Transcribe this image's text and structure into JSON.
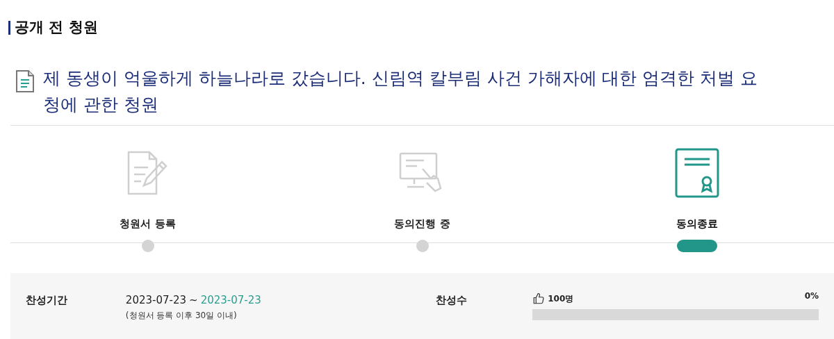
{
  "section_title": "공개 전 청원",
  "petition_title": "제 동생이 억울하게 하늘나라로 갔습니다. 신림역 칼부림 사건 가해자에 대한 엄격한 처벌 요청에 관한 청원",
  "steps": [
    {
      "kind": "register",
      "label": "청원서 등록",
      "selected": false
    },
    {
      "kind": "consent",
      "label": "동의진행 중",
      "selected": false
    },
    {
      "kind": "closed",
      "label": "동의종료",
      "selected": true
    }
  ],
  "period": {
    "label": "찬성기간",
    "start": "2023-07-23",
    "separator": "~",
    "end": "2023-07-23",
    "note": "(청원서 등록 이후 30일 이내)"
  },
  "votes": {
    "label": "찬성수",
    "count": "100명",
    "percent": "0%",
    "level": 0
  }
}
